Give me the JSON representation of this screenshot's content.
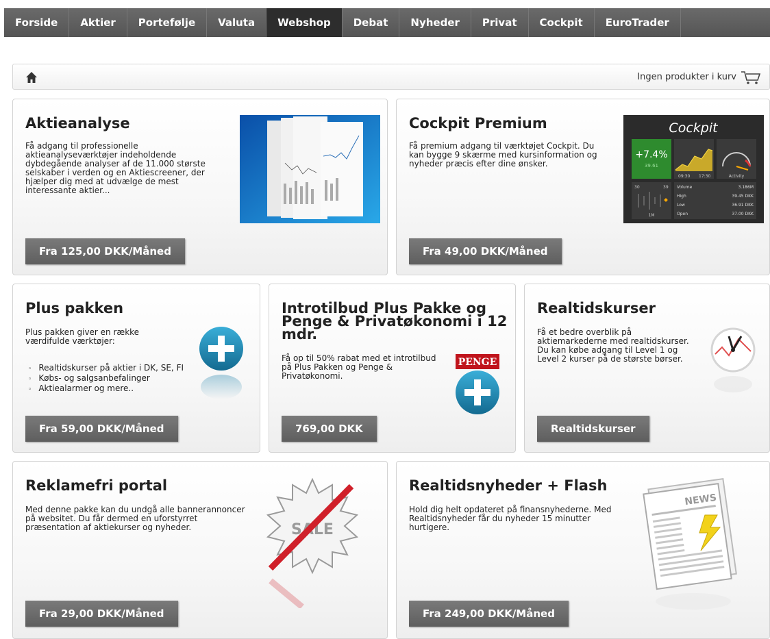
{
  "nav": {
    "items": [
      "Forside",
      "Aktier",
      "Portefølje",
      "Valuta",
      "Webshop",
      "Debat",
      "Nyheder",
      "Privat",
      "Cockpit",
      "EuroTrader"
    ],
    "active": "Webshop"
  },
  "breadcrumb": {
    "cart_text": "Ingen produkter i kurv"
  },
  "products": {
    "aktieanalyse": {
      "title": "Aktieanalyse",
      "description": "Få adgang til professionelle aktieanalyseværktøjer indeholdende dybdegående analyser af de 11.000 største selskaber i verden og en Aktiescreener, der hjælper dig med at udvælge de mest interessante aktier...",
      "price": "Fra 125,00 DKK/Måned"
    },
    "cockpit": {
      "title": "Cockpit Premium",
      "description": "Få premium adgang til værktøjet Cockpit. Du kan bygge 9 skærme med kursinformation og nyheder præcis efter dine ønsker.",
      "price": "Fra 49,00 DKK/Måned",
      "thumb": {
        "title": "Cockpit",
        "change": "+7.4%",
        "sub": "39.61",
        "t1": "09:30",
        "t2": "17:30",
        "activity": "Activity",
        "range1": "30",
        "range2": "39",
        "volume_label": "Volume",
        "volume": "3.186M",
        "high_label": "High",
        "high": "39.45 DKK",
        "low_label": "Low",
        "low": "36.91 DKK",
        "open_label": "Open",
        "open": "37.00 DKK",
        "period": "1M"
      }
    },
    "plus": {
      "title": "Plus pakken",
      "description": "Plus pakken giver en række værdifulde værktøjer:",
      "bullets": [
        "Realtidskurser på aktier i DK, SE, FI",
        "Købs- og salgsanbefalinger",
        "Aktiealarmer og mere.."
      ],
      "price": "Fra 59,00 DKK/Måned"
    },
    "intro": {
      "title": "Introtilbud Plus Pakke og Penge & Privatøkonomi i 12 mdr.",
      "description": "Få op til 50% rabat med et introtilbud på Plus Pakken og Penge & Privatøkonomi.",
      "price": "769,00 DKK",
      "logo_text": "PENGE"
    },
    "realtid": {
      "title": "Realtidskurser",
      "description": "Få et bedre overblik på aktiemarkederne med realtidskurser. Du kan købe adgang til Level 1 og Level 2 kurser på de største børser.",
      "price": "Realtidskurser"
    },
    "reklamefri": {
      "title": "Reklamefri portal",
      "description": "Med denne pakke kan du undgå alle bannerannoncer på websitet. Du får dermed en uforstyrret præsentation af aktiekurser og nyheder.",
      "price": "Fra 29,00 DKK/Måned",
      "sale_text": "SALE"
    },
    "nyheder": {
      "title": "Realtidsnyheder + Flash",
      "description": "Hold dig helt opdateret på finansnyhederne. Med Realtidsnyheder får du nyheder 15 minutter hurtigere.",
      "price": "Fra 249,00 DKK/Måned",
      "news_text": "NEWS"
    }
  },
  "colors": {
    "nav_bg": "#5a5a5a",
    "nav_active": "#2d2d2d",
    "button": "#6b6b6b",
    "plus_blue": "#1b7fa8",
    "sale_red": "#d0202a",
    "bolt_yellow": "#f2d21b"
  }
}
